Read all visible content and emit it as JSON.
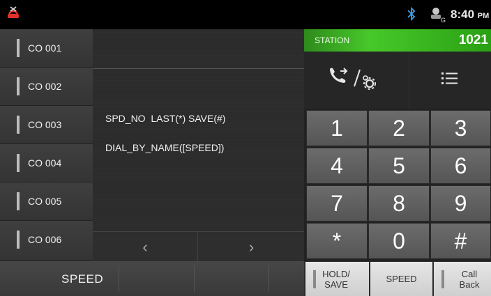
{
  "status_bar": {
    "left_icon": "phone-hook-icon",
    "bluetooth_icon": "bluetooth-icon",
    "signal_icon": "network-g-icon",
    "time": "8:40",
    "ampm": "PM"
  },
  "co_lines": [
    {
      "label": "CO 001"
    },
    {
      "label": "CO 002"
    },
    {
      "label": "CO 003"
    },
    {
      "label": "CO 004"
    },
    {
      "label": "CO 005"
    },
    {
      "label": "CO 006"
    }
  ],
  "display": {
    "line1": "SPD_NO  LAST(*) SAVE(#)",
    "line2": "DIAL_BY_NAME([SPEED])",
    "prev_glyph": "‹",
    "next_glyph": "›"
  },
  "station": {
    "label": "STATION",
    "number": "1021"
  },
  "function_row": {
    "call_settings_icon": "call-forward-settings-icon",
    "list_icon": "list-icon"
  },
  "keypad": [
    "1",
    "2",
    "3",
    "4",
    "5",
    "6",
    "7",
    "8",
    "9",
    "*",
    "0",
    "#"
  ],
  "bottom": {
    "speed_left": "SPEED",
    "hold_save": [
      "HOLD/",
      "SAVE"
    ],
    "speed_right": "SPEED",
    "call_back": [
      "Call",
      "Back"
    ]
  },
  "colors": {
    "station_green": "#47c82a",
    "hook_red": "#e0302a",
    "bluetooth_blue": "#3aa0e8"
  }
}
